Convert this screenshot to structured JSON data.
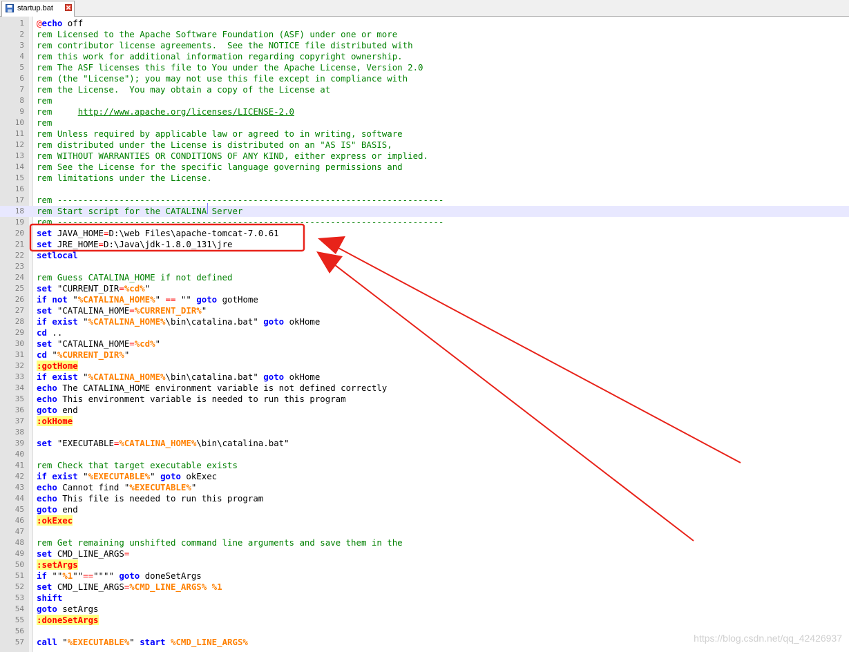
{
  "tab": {
    "icon": "save-disk-icon",
    "label": "startup.bat",
    "close_icon": "close-icon"
  },
  "editor": {
    "current_line": 18,
    "lines": [
      [
        [
          "at",
          "@"
        ],
        [
          "kw",
          "echo"
        ],
        [
          "txt",
          " off"
        ]
      ],
      [
        [
          "rem",
          "rem Licensed to the Apache Software Foundation (ASF) under one or more"
        ]
      ],
      [
        [
          "rem",
          "rem contributor license agreements.  See the NOTICE file distributed with"
        ]
      ],
      [
        [
          "rem",
          "rem this work for additional information regarding copyright ownership."
        ]
      ],
      [
        [
          "rem",
          "rem The ASF licenses this file to You under the Apache License, Version 2.0"
        ]
      ],
      [
        [
          "rem",
          "rem (the \"License\"); you may not use this file except in compliance with"
        ]
      ],
      [
        [
          "rem",
          "rem the License.  You may obtain a copy of the License at"
        ]
      ],
      [
        [
          "rem",
          "rem"
        ]
      ],
      [
        [
          "rem",
          "rem     "
        ],
        [
          "link",
          "http://www.apache.org/licenses/LICENSE-2.0"
        ]
      ],
      [
        [
          "rem",
          "rem"
        ]
      ],
      [
        [
          "rem",
          "rem Unless required by applicable law or agreed to in writing, software"
        ]
      ],
      [
        [
          "rem",
          "rem distributed under the License is distributed on an \"AS IS\" BASIS,"
        ]
      ],
      [
        [
          "rem",
          "rem WITHOUT WARRANTIES OR CONDITIONS OF ANY KIND, either express or implied."
        ]
      ],
      [
        [
          "rem",
          "rem See the License for the specific language governing permissions and"
        ]
      ],
      [
        [
          "rem",
          "rem limitations under the License."
        ]
      ],
      [],
      [
        [
          "rem",
          "rem ---------------------------------------------------------------------------"
        ]
      ],
      [
        [
          "rem",
          "rem Start script for the CATALINA Server"
        ]
      ],
      [
        [
          "rem",
          "rem ---------------------------------------------------------------------------"
        ]
      ],
      [
        [
          "kw",
          "set"
        ],
        [
          "txt",
          " JAVA_HOME"
        ],
        [
          "op",
          "="
        ],
        [
          "txt",
          "D:\\web Files\\apache-tomcat-7.0.61"
        ]
      ],
      [
        [
          "kw",
          "set"
        ],
        [
          "txt",
          " JRE_HOME"
        ],
        [
          "op",
          "="
        ],
        [
          "txt",
          "D:\\Java\\jdk-1.8.0_131\\jre"
        ]
      ],
      [
        [
          "kw",
          "setlocal"
        ]
      ],
      [],
      [
        [
          "rem",
          "rem Guess CATALINA_HOME if not defined"
        ]
      ],
      [
        [
          "kw",
          "set"
        ],
        [
          "txt",
          " \"CURRENT_DIR"
        ],
        [
          "op",
          "="
        ],
        [
          "var",
          "%cd%"
        ],
        [
          "txt",
          "\""
        ]
      ],
      [
        [
          "kw",
          "if"
        ],
        [
          "txt",
          " "
        ],
        [
          "kw",
          "not"
        ],
        [
          "txt",
          " \""
        ],
        [
          "var",
          "%CATALINA_HOME%"
        ],
        [
          "txt",
          "\" "
        ],
        [
          "op",
          "=="
        ],
        [
          "txt",
          " \"\" "
        ],
        [
          "kw",
          "goto"
        ],
        [
          "txt",
          " gotHome"
        ]
      ],
      [
        [
          "kw",
          "set"
        ],
        [
          "txt",
          " \"CATALINA_HOME"
        ],
        [
          "op",
          "="
        ],
        [
          "var",
          "%CURRENT_DIR%"
        ],
        [
          "txt",
          "\""
        ]
      ],
      [
        [
          "kw",
          "if"
        ],
        [
          "txt",
          " "
        ],
        [
          "kw",
          "exist"
        ],
        [
          "txt",
          " \""
        ],
        [
          "var",
          "%CATALINA_HOME%"
        ],
        [
          "txt",
          "\\bin\\catalina.bat\" "
        ],
        [
          "kw",
          "goto"
        ],
        [
          "txt",
          " okHome"
        ]
      ],
      [
        [
          "kw",
          "cd"
        ],
        [
          "txt",
          " .."
        ]
      ],
      [
        [
          "kw",
          "set"
        ],
        [
          "txt",
          " \"CATALINA_HOME"
        ],
        [
          "op",
          "="
        ],
        [
          "var",
          "%cd%"
        ],
        [
          "txt",
          "\""
        ]
      ],
      [
        [
          "kw",
          "cd"
        ],
        [
          "txt",
          " \""
        ],
        [
          "var",
          "%CURRENT_DIR%"
        ],
        [
          "txt",
          "\""
        ]
      ],
      [
        [
          "label",
          ":gotHome"
        ]
      ],
      [
        [
          "kw",
          "if"
        ],
        [
          "txt",
          " "
        ],
        [
          "kw",
          "exist"
        ],
        [
          "txt",
          " \""
        ],
        [
          "var",
          "%CATALINA_HOME%"
        ],
        [
          "txt",
          "\\bin\\catalina.bat\" "
        ],
        [
          "kw",
          "goto"
        ],
        [
          "txt",
          " okHome"
        ]
      ],
      [
        [
          "kw",
          "echo"
        ],
        [
          "txt",
          " The CATALINA_HOME environment variable is not defined correctly"
        ]
      ],
      [
        [
          "kw",
          "echo"
        ],
        [
          "txt",
          " This environment variable is needed to run this program"
        ]
      ],
      [
        [
          "kw",
          "goto"
        ],
        [
          "txt",
          " end"
        ]
      ],
      [
        [
          "label",
          ":okHome"
        ]
      ],
      [],
      [
        [
          "kw",
          "set"
        ],
        [
          "txt",
          " \"EXECUTABLE"
        ],
        [
          "op",
          "="
        ],
        [
          "var",
          "%CATALINA_HOME%"
        ],
        [
          "txt",
          "\\bin\\catalina.bat\""
        ]
      ],
      [],
      [
        [
          "rem",
          "rem Check that target executable exists"
        ]
      ],
      [
        [
          "kw",
          "if"
        ],
        [
          "txt",
          " "
        ],
        [
          "kw",
          "exist"
        ],
        [
          "txt",
          " \""
        ],
        [
          "var",
          "%EXECUTABLE%"
        ],
        [
          "txt",
          "\" "
        ],
        [
          "kw",
          "goto"
        ],
        [
          "txt",
          " okExec"
        ]
      ],
      [
        [
          "kw",
          "echo"
        ],
        [
          "txt",
          " Cannot find \""
        ],
        [
          "var",
          "%EXECUTABLE%"
        ],
        [
          "txt",
          "\""
        ]
      ],
      [
        [
          "kw",
          "echo"
        ],
        [
          "txt",
          " This file is needed to run this program"
        ]
      ],
      [
        [
          "kw",
          "goto"
        ],
        [
          "txt",
          " end"
        ]
      ],
      [
        [
          "label",
          ":okExec"
        ]
      ],
      [],
      [
        [
          "rem",
          "rem Get remaining unshifted command line arguments and save them in the"
        ]
      ],
      [
        [
          "kw",
          "set"
        ],
        [
          "txt",
          " CMD_LINE_ARGS"
        ],
        [
          "op",
          "="
        ]
      ],
      [
        [
          "label",
          ":setArgs"
        ]
      ],
      [
        [
          "kw",
          "if"
        ],
        [
          "txt",
          " \"\""
        ],
        [
          "var",
          "%1"
        ],
        [
          "txt",
          "\"\""
        ],
        [
          "op",
          "=="
        ],
        [
          "txt",
          "\"\"\"\" "
        ],
        [
          "kw",
          "goto"
        ],
        [
          "txt",
          " doneSetArgs"
        ]
      ],
      [
        [
          "kw",
          "set"
        ],
        [
          "txt",
          " CMD_LINE_ARGS"
        ],
        [
          "op",
          "="
        ],
        [
          "var",
          "%CMD_LINE_ARGS%"
        ],
        [
          "txt",
          " "
        ],
        [
          "var",
          "%1"
        ]
      ],
      [
        [
          "kw",
          "shift"
        ]
      ],
      [
        [
          "kw",
          "goto"
        ],
        [
          "txt",
          " setArgs"
        ]
      ],
      [
        [
          "label",
          ":doneSetArgs"
        ]
      ],
      [],
      [
        [
          "kw",
          "call"
        ],
        [
          "txt",
          " \""
        ],
        [
          "var",
          "%EXECUTABLE%"
        ],
        [
          "txt",
          "\" "
        ],
        [
          "kw",
          "start"
        ],
        [
          "txt",
          " "
        ],
        [
          "var",
          "%CMD_LINE_ARGS%"
        ]
      ]
    ]
  },
  "colors": {
    "annotation": "#e8231a",
    "comment": "#008000",
    "keyword": "#0000ff",
    "variable": "#ff8000",
    "label_bg": "#ffff80"
  },
  "watermark": "https://blog.csdn.net/qq_42426937"
}
